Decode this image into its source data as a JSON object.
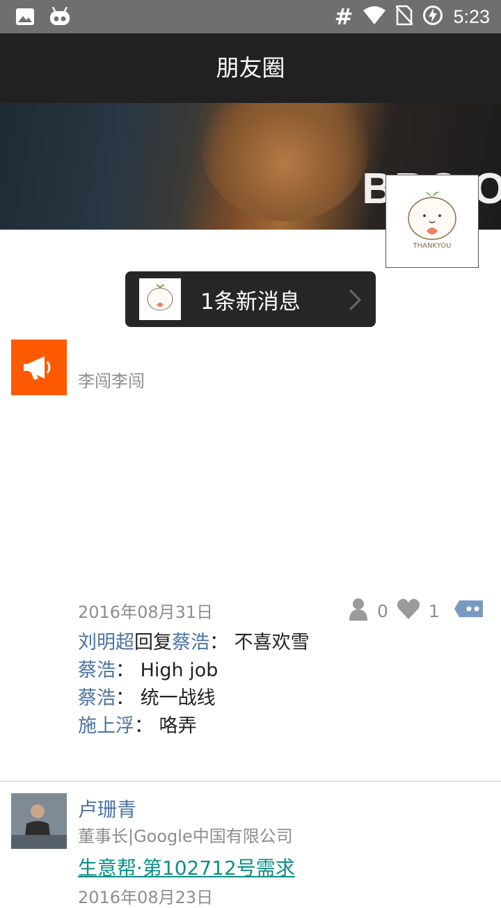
{
  "status_bar": {
    "time": "5:23",
    "left_icons": [
      "image-icon",
      "android-icon"
    ],
    "right_icons": [
      "hash-icon",
      "wifi-icon",
      "no-sim-icon",
      "battery-charging-icon"
    ],
    "hash": "#"
  },
  "header": {
    "title": "朋友圈"
  },
  "cover": {
    "overlay_text": "BBC O"
  },
  "new_message": {
    "text": "1条新消息"
  },
  "post1": {
    "author": "李闯李闯",
    "date": "2016年08月31日",
    "views": "0",
    "likes": "1",
    "comments": [
      {
        "name": "刘明超",
        "reply_word": "回复",
        "reply_to": "蔡浩",
        "sep": "： ",
        "text": "不喜欢雪"
      },
      {
        "name": "蔡浩",
        "sep": "： ",
        "text": "High job"
      },
      {
        "name": "蔡浩",
        "sep": "： ",
        "text": "统一战线"
      },
      {
        "name": "施上浮",
        "sep": "： ",
        "text": "咯弄"
      }
    ]
  },
  "post2": {
    "author": "卢珊青",
    "subtitle": "董事长|Google中国有限公司",
    "link_text": "生意帮·第102712号需求",
    "date": "2016年08月23日"
  },
  "colors": {
    "status_bar": "#6f6f6f",
    "title_bar": "#212121",
    "name_blue": "#4b73a3",
    "link_teal": "#0b8f86",
    "orange": "#ff5a00"
  }
}
